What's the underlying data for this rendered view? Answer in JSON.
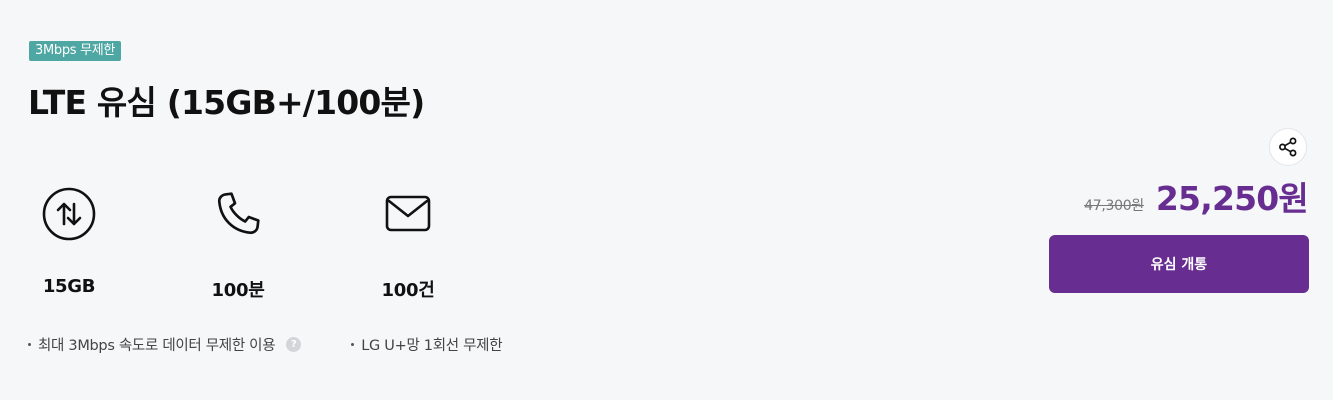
{
  "plan": {
    "badge": "3Mbps 무제한",
    "title": "LTE 유심 (15GB+/100분)"
  },
  "features": {
    "data": {
      "icon": "data-transfer-icon",
      "label": "15GB"
    },
    "call": {
      "icon": "phone-icon",
      "label": "100분"
    },
    "sms": {
      "icon": "mail-icon",
      "label": "100건"
    }
  },
  "notes": [
    {
      "text": "최대 3Mbps 속도로 데이터 무제한 이용",
      "help_icon": "help-icon",
      "help_glyph": "?"
    },
    {
      "text": "LG U+망 1회선 무제한"
    }
  ],
  "pricing": {
    "original_price": "47,300원",
    "sale_price": "25,250원"
  },
  "actions": {
    "share_icon": "share-icon",
    "cta_label": "유심 개통"
  },
  "colors": {
    "background": "#f6f7f9",
    "badge": "#4ea7a3",
    "brand_purple": "#672d91"
  }
}
